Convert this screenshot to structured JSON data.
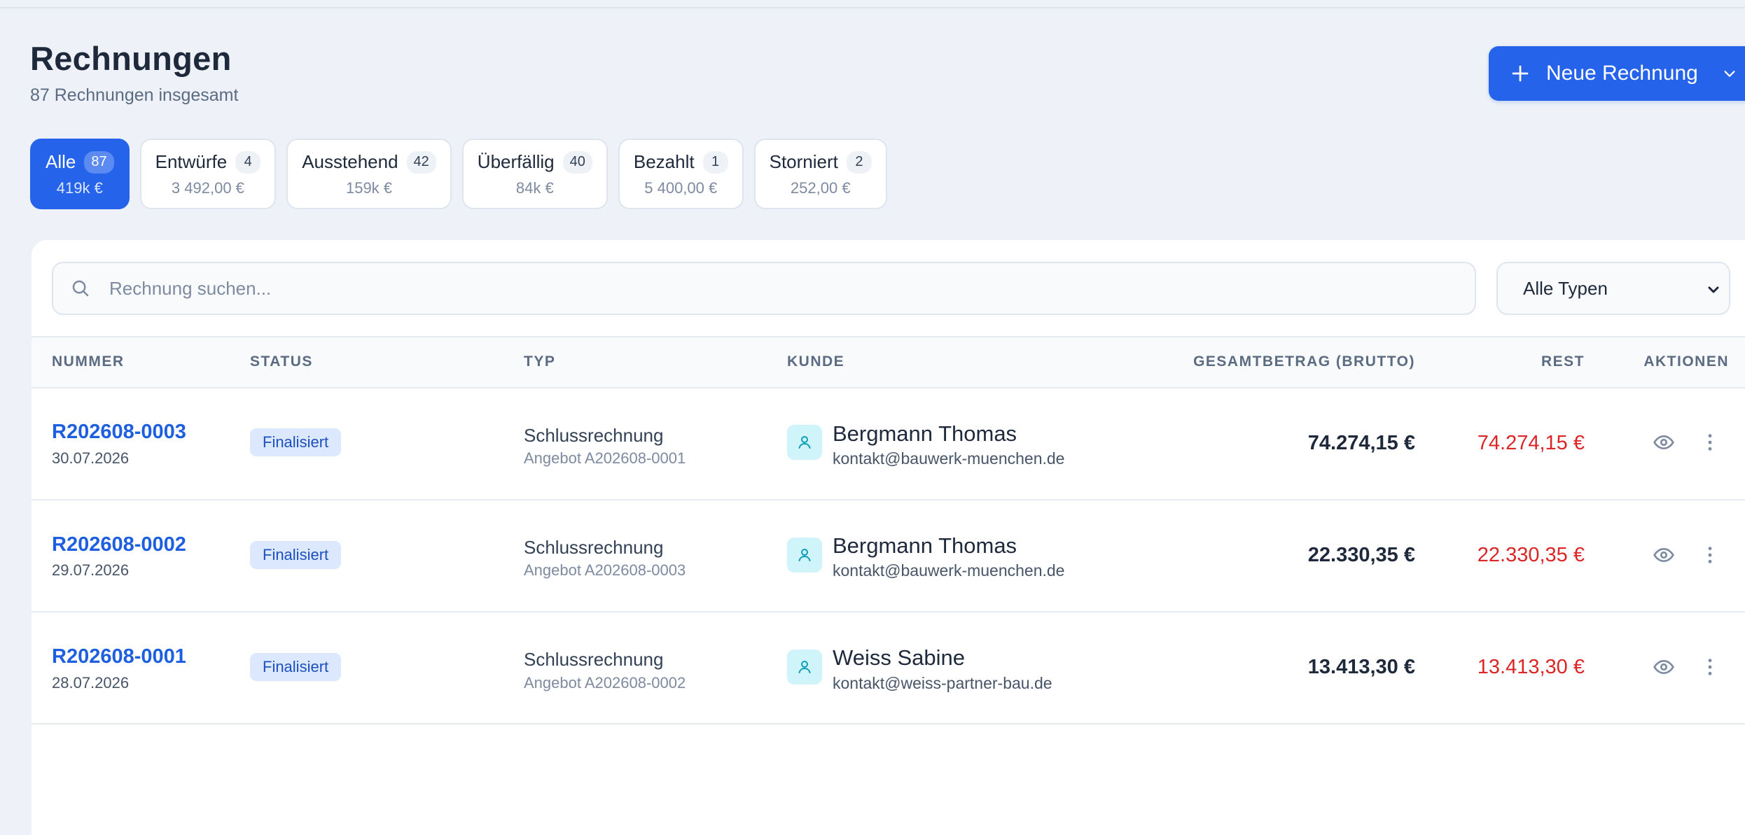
{
  "header": {
    "title": "Rechnungen",
    "subtitle": "87 Rechnungen insgesamt",
    "new_button_label": "Neue Rechnung"
  },
  "filters": [
    {
      "name": "Alle",
      "count": "87",
      "amount": "419k €",
      "active": true
    },
    {
      "name": "Entwürfe",
      "count": "4",
      "amount": "3 492,00 €",
      "active": false
    },
    {
      "name": "Ausstehend",
      "count": "42",
      "amount": "159k €",
      "active": false
    },
    {
      "name": "Überfällig",
      "count": "40",
      "amount": "84k €",
      "active": false
    },
    {
      "name": "Bezahlt",
      "count": "1",
      "amount": "5 400,00 €",
      "active": false
    },
    {
      "name": "Storniert",
      "count": "2",
      "amount": "252,00 €",
      "active": false
    }
  ],
  "search": {
    "placeholder": "Rechnung suchen...",
    "value": ""
  },
  "type_select": {
    "value": "Alle Typen"
  },
  "table": {
    "headers": {
      "number": "NUMMER",
      "status": "STATUS",
      "type": "TYP",
      "customer": "KUNDE",
      "total": "GESAMTBETRAG (BRUTTO)",
      "rest": "REST",
      "actions": "AKTIONEN"
    },
    "rows": [
      {
        "number": "R202608-0003",
        "date": "30.07.2026",
        "status": "Finalisiert",
        "type": "Schlussrechnung",
        "type_sub": "Angebot A202608-0001",
        "customer": "Bergmann Thomas",
        "email": "kontakt@bauwerk-muenchen.de",
        "total": "74.274,15 €",
        "rest": "74.274,15 €"
      },
      {
        "number": "R202608-0002",
        "date": "29.07.2026",
        "status": "Finalisiert",
        "type": "Schlussrechnung",
        "type_sub": "Angebot A202608-0003",
        "customer": "Bergmann Thomas",
        "email": "kontakt@bauwerk-muenchen.de",
        "total": "22.330,35 €",
        "rest": "22.330,35 €"
      },
      {
        "number": "R202608-0001",
        "date": "28.07.2026",
        "status": "Finalisiert",
        "type": "Schlussrechnung",
        "type_sub": "Angebot A202608-0002",
        "customer": "Weiss Sabine",
        "email": "kontakt@weiss-partner-bau.de",
        "total": "13.413,30 €",
        "rest": "13.413,30 €"
      }
    ]
  },
  "icons": {
    "new_button": "plus-icon",
    "new_button_menu": "chevron-down-icon",
    "search": "search-icon",
    "customer": "user-icon",
    "view": "eye-icon",
    "more": "more-vertical-icon"
  },
  "colors": {
    "accent": "#2563eb",
    "rest_amount": "#dc2626",
    "badge_bg": "#dbe8fd",
    "badge_text": "#1d4fbf",
    "avatar_bg": "#cff4fa"
  }
}
